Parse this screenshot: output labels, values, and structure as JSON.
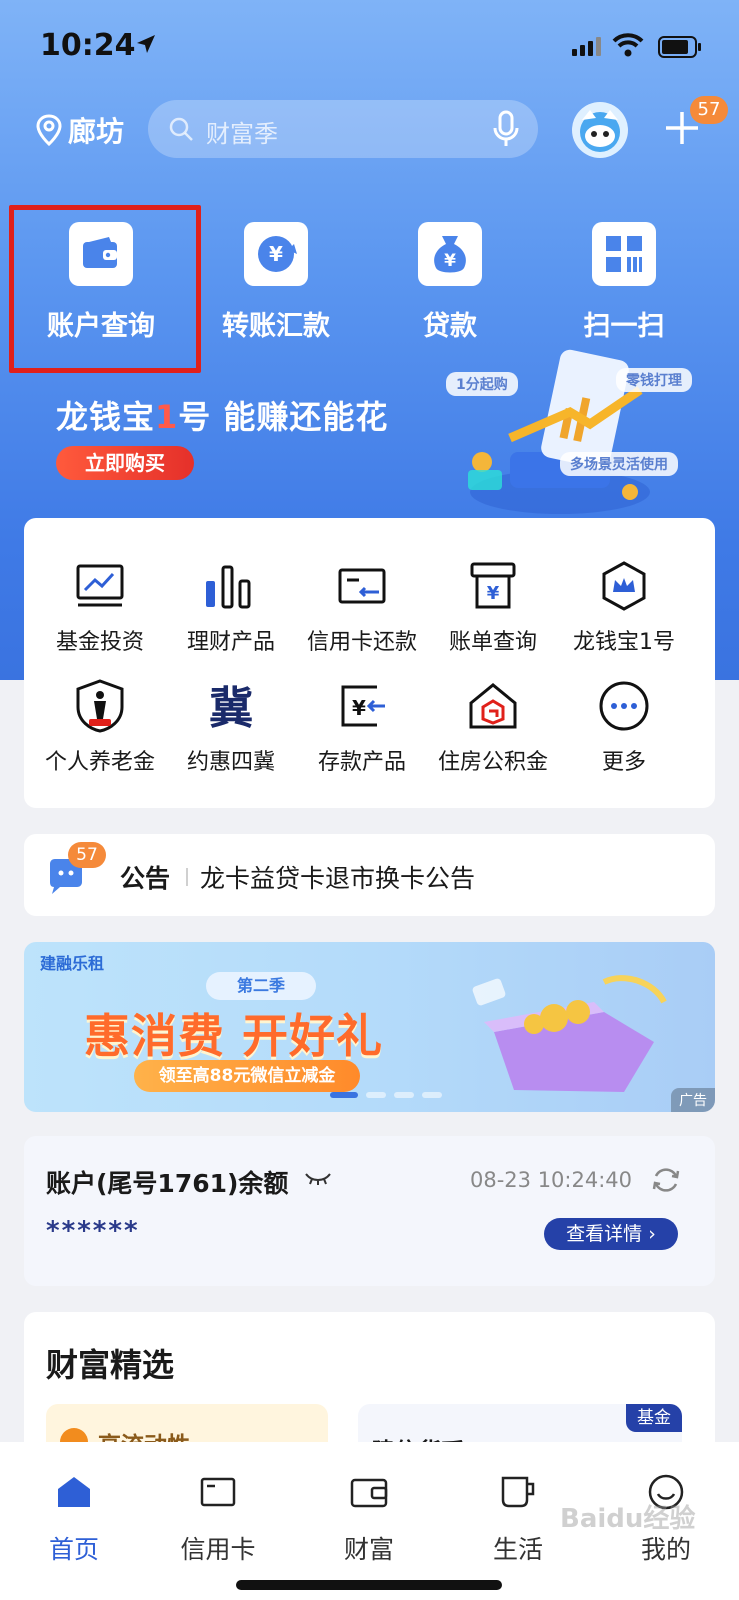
{
  "status_bar": {
    "time": "10:24"
  },
  "header": {
    "city": "廊坊",
    "search_placeholder": "财富季",
    "notification_count": "57"
  },
  "quick_actions": [
    {
      "label": "账户查询",
      "icon": "wallet-icon"
    },
    {
      "label": "转账汇款",
      "icon": "transfer-yuan-icon"
    },
    {
      "label": "贷款",
      "icon": "money-bag-icon"
    },
    {
      "label": "扫一扫",
      "icon": "scan-icon"
    }
  ],
  "promo": {
    "title_prefix": "龙钱宝",
    "title_accent": "1",
    "title_suffix": "号 能赚还能花",
    "button": "立即购买",
    "tags": [
      "1分起购",
      "零钱打理",
      "多场景灵活使用"
    ]
  },
  "services": [
    {
      "label": "基金投资",
      "icon": "fund-chart-icon"
    },
    {
      "label": "理财产品",
      "icon": "bar-chart-icon"
    },
    {
      "label": "信用卡还款",
      "icon": "credit-card-icon"
    },
    {
      "label": "账单查询",
      "icon": "bill-icon"
    },
    {
      "label": "龙钱宝1号",
      "icon": "crown-hexagon-icon"
    },
    {
      "label": "个人养老金",
      "icon": "pension-shield-icon"
    },
    {
      "label": "约惠四冀",
      "icon": "ji-character-icon"
    },
    {
      "label": "存款产品",
      "icon": "deposit-icon"
    },
    {
      "label": "住房公积金",
      "icon": "house-icon"
    },
    {
      "label": "更多",
      "icon": "more-dots-icon"
    }
  ],
  "notice": {
    "badge": "57",
    "label": "公告",
    "text": "龙卡益贷卡退市换卡公告"
  },
  "banner": {
    "brand": "建融乐租",
    "season": "第二季",
    "headline": "惠消费 开好礼",
    "sub": "领至高88元微信立减金",
    "ad_label": "广告"
  },
  "balance": {
    "title": "账户(尾号1761)余额",
    "timestamp": "08-23 10:24:40",
    "value": "******",
    "detail_button": "查看详情"
  },
  "wealth": {
    "title": "财富精选",
    "left_item": "高流动性",
    "right_item": "建信货币B",
    "fund_tag": "基金"
  },
  "tabs": [
    {
      "label": "首页",
      "icon": "home-icon",
      "active": true
    },
    {
      "label": "信用卡",
      "icon": "card-icon",
      "active": false
    },
    {
      "label": "财富",
      "icon": "wallet-tab-icon",
      "active": false
    },
    {
      "label": "生活",
      "icon": "cup-icon",
      "active": false
    },
    {
      "label": "我的",
      "icon": "smile-icon",
      "active": false
    }
  ],
  "watermark": "Baidu经验",
  "colors": {
    "primary": "#3a73e0",
    "accent_red": "#e0201a",
    "badge_orange": "#f58a3a",
    "navy": "#2541a8"
  }
}
